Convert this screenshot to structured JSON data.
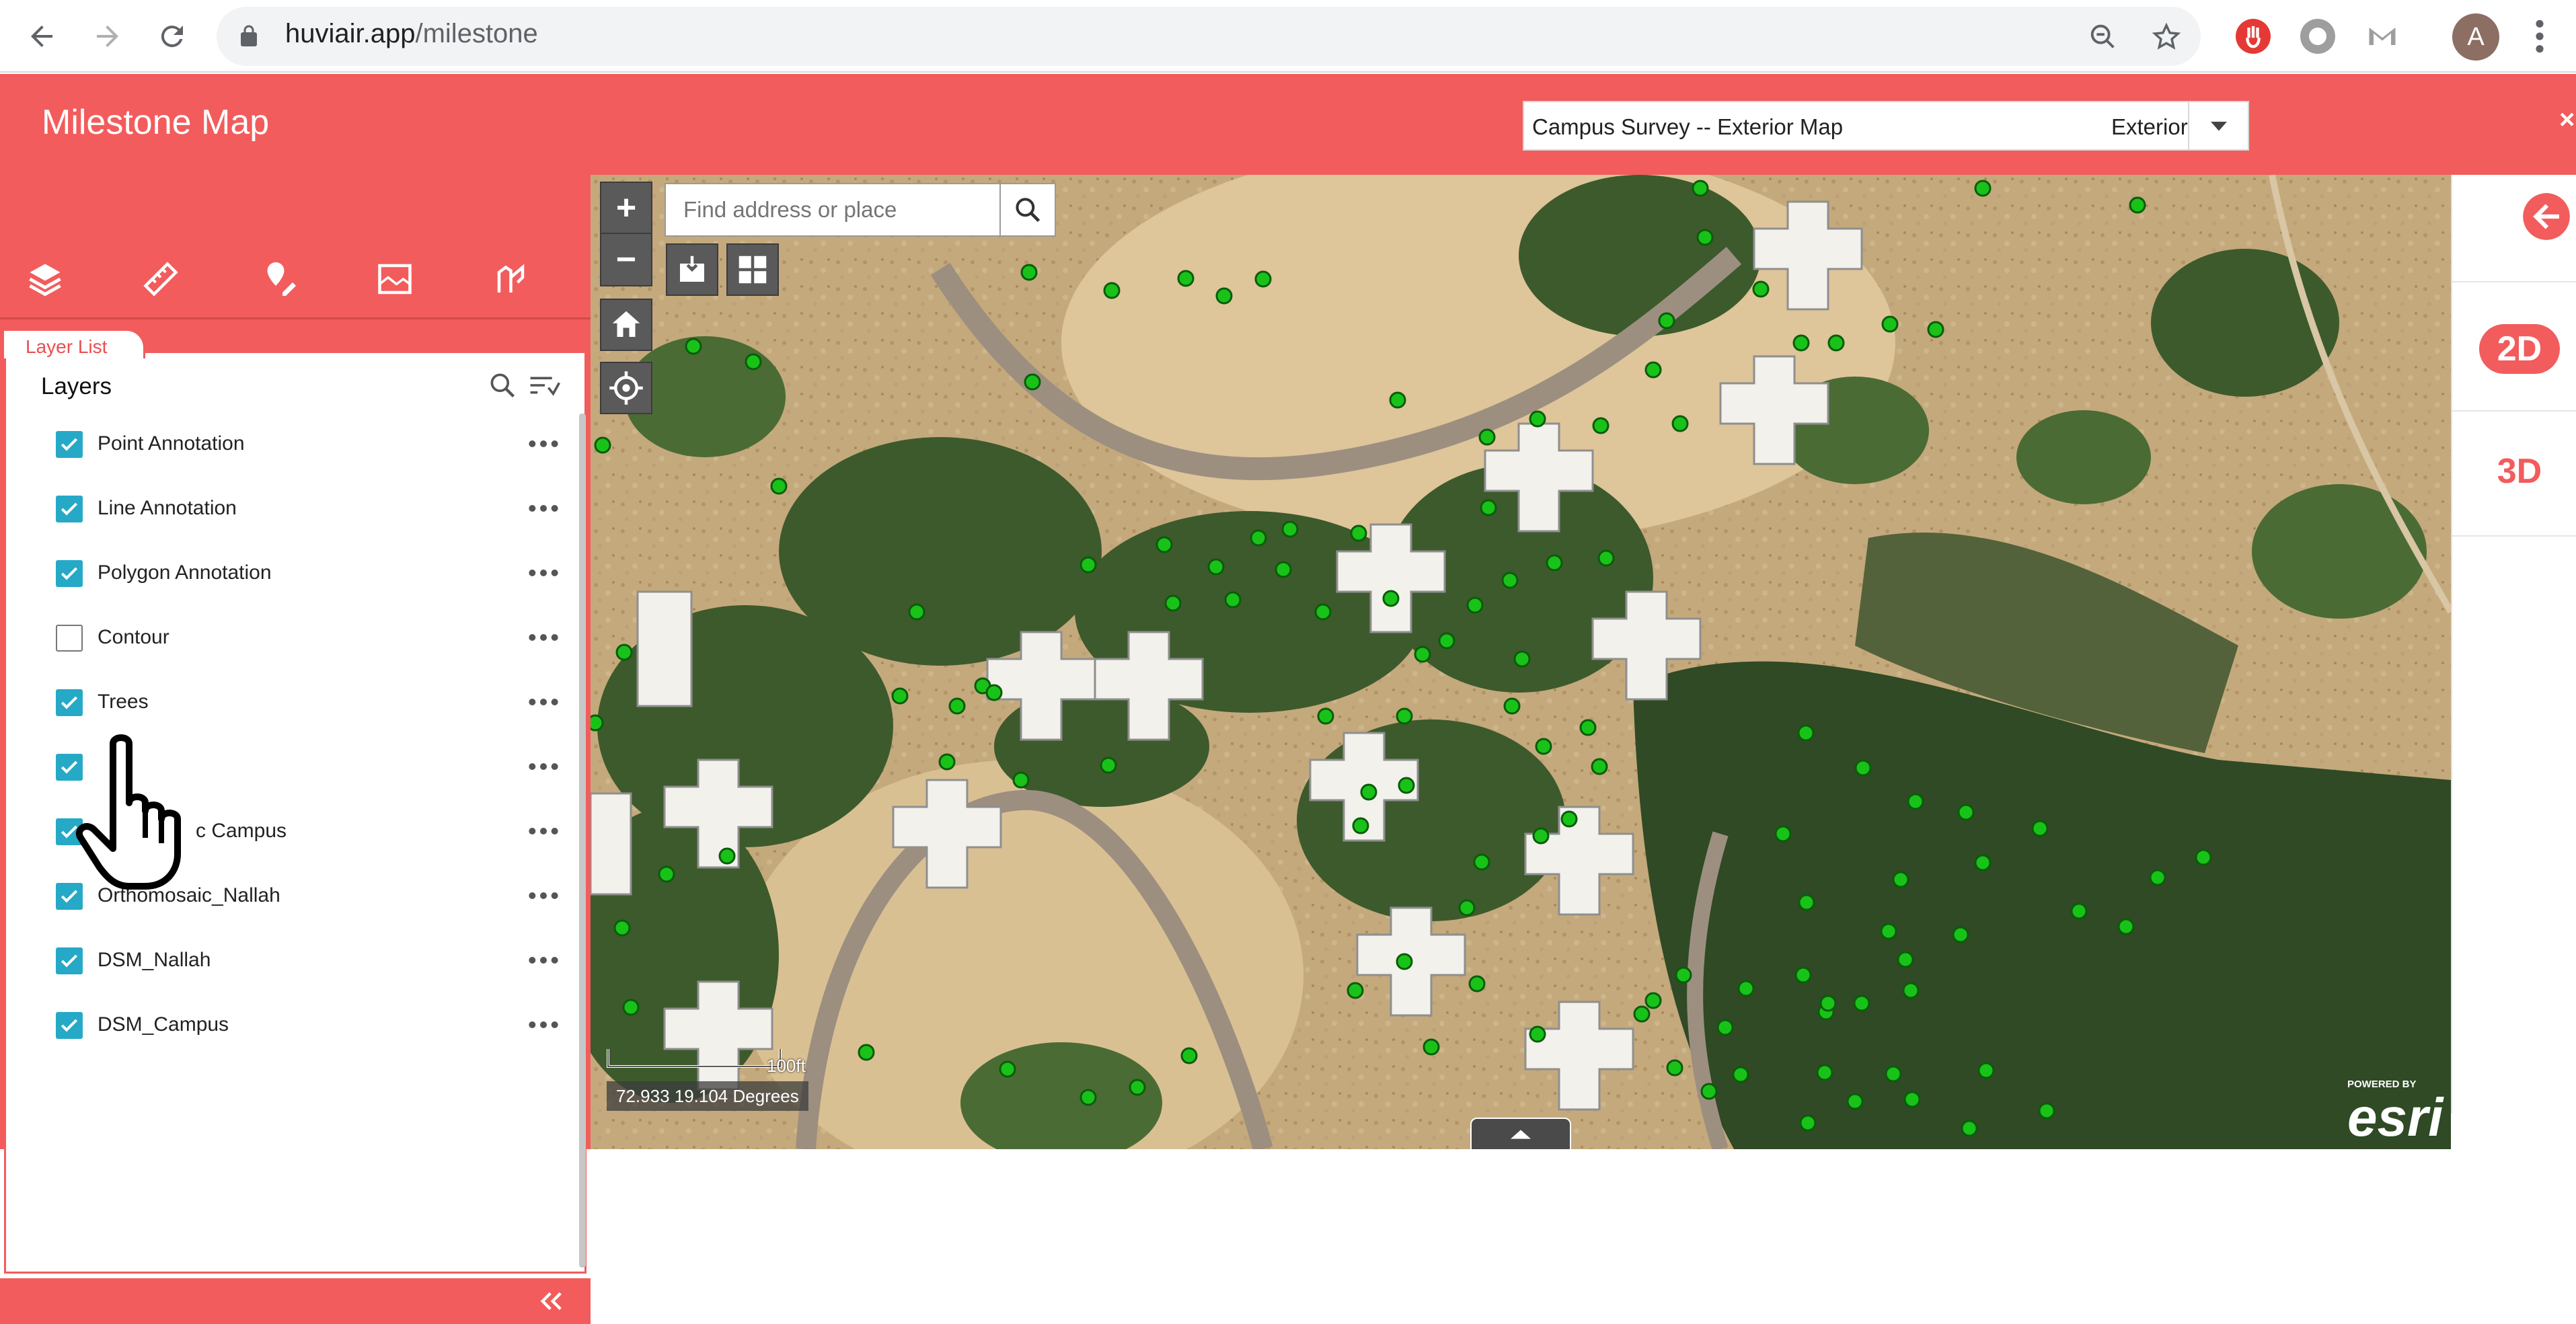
{
  "browser": {
    "url_host": "huviair.app",
    "url_path": "/milestone",
    "avatar_initial": "A"
  },
  "app": {
    "title": "Milestone Map",
    "map_selector": {
      "label": "Campus Survey -- Exterior Map",
      "value": "Exterior"
    },
    "close_glyph": "×"
  },
  "toolbar": {
    "icons": [
      "layers-icon",
      "measure-ruler-icon",
      "draw-marker-icon",
      "basemap-icon",
      "annotate-icon"
    ]
  },
  "layer_list": {
    "tab_label": "Layer List",
    "title": "Layers",
    "layers": [
      {
        "label": "Point Annotation",
        "checked": true
      },
      {
        "label": "Line Annotation",
        "checked": true
      },
      {
        "label": "Polygon Annotation",
        "checked": true
      },
      {
        "label": "Contour",
        "checked": false
      },
      {
        "label": "Trees",
        "checked": true
      },
      {
        "label": "",
        "checked": true
      },
      {
        "label": "c Campus",
        "checked": true
      },
      {
        "label": "Orthomosaic_Nallah",
        "checked": true
      },
      {
        "label": "DSM_Nallah",
        "checked": true
      },
      {
        "label": "DSM_Campus",
        "checked": true
      }
    ]
  },
  "map": {
    "search_placeholder": "Find address or place",
    "zoom_in": "+",
    "zoom_out": "−",
    "scale_label": "100ft",
    "coordinates": "72.933 19.104 Degrees",
    "attribution_powered": "POWERED BY",
    "attribution_brand": "esri"
  },
  "right_panel": {
    "mode_2d": "2D",
    "mode_3d": "3D"
  },
  "colors": {
    "brand_red": "#f25c5c",
    "checkbox_teal": "#26a9c6",
    "tree_point_green": "#19c219"
  }
}
